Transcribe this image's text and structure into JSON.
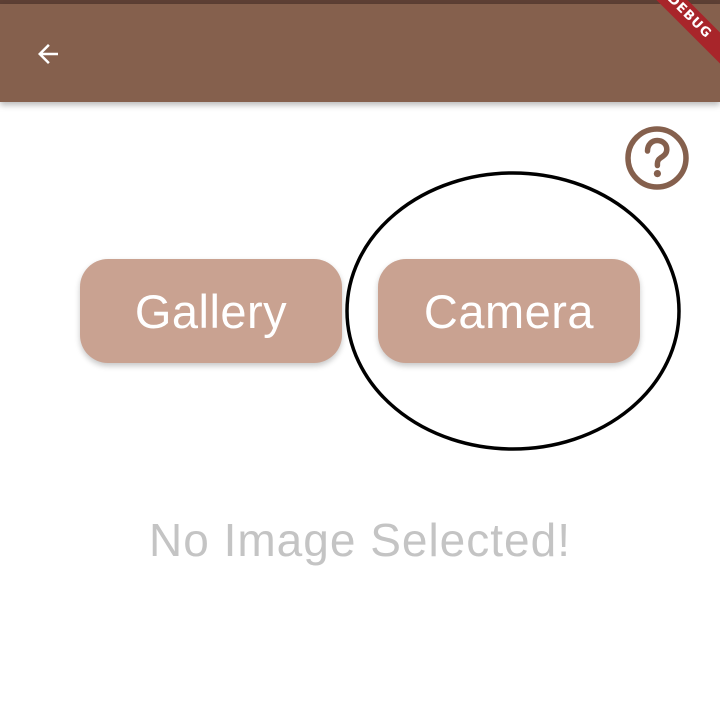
{
  "app_bar": {
    "back_icon": "arrow-left-icon",
    "debug_banner": "DEBUG",
    "color": "#85604d"
  },
  "help": {
    "icon": "question-circle-icon",
    "color": "#85604d"
  },
  "buttons": {
    "gallery_label": "Gallery",
    "camera_label": "Camera",
    "color": "#c9a291"
  },
  "message": {
    "empty_text": "No Image Selected!"
  }
}
